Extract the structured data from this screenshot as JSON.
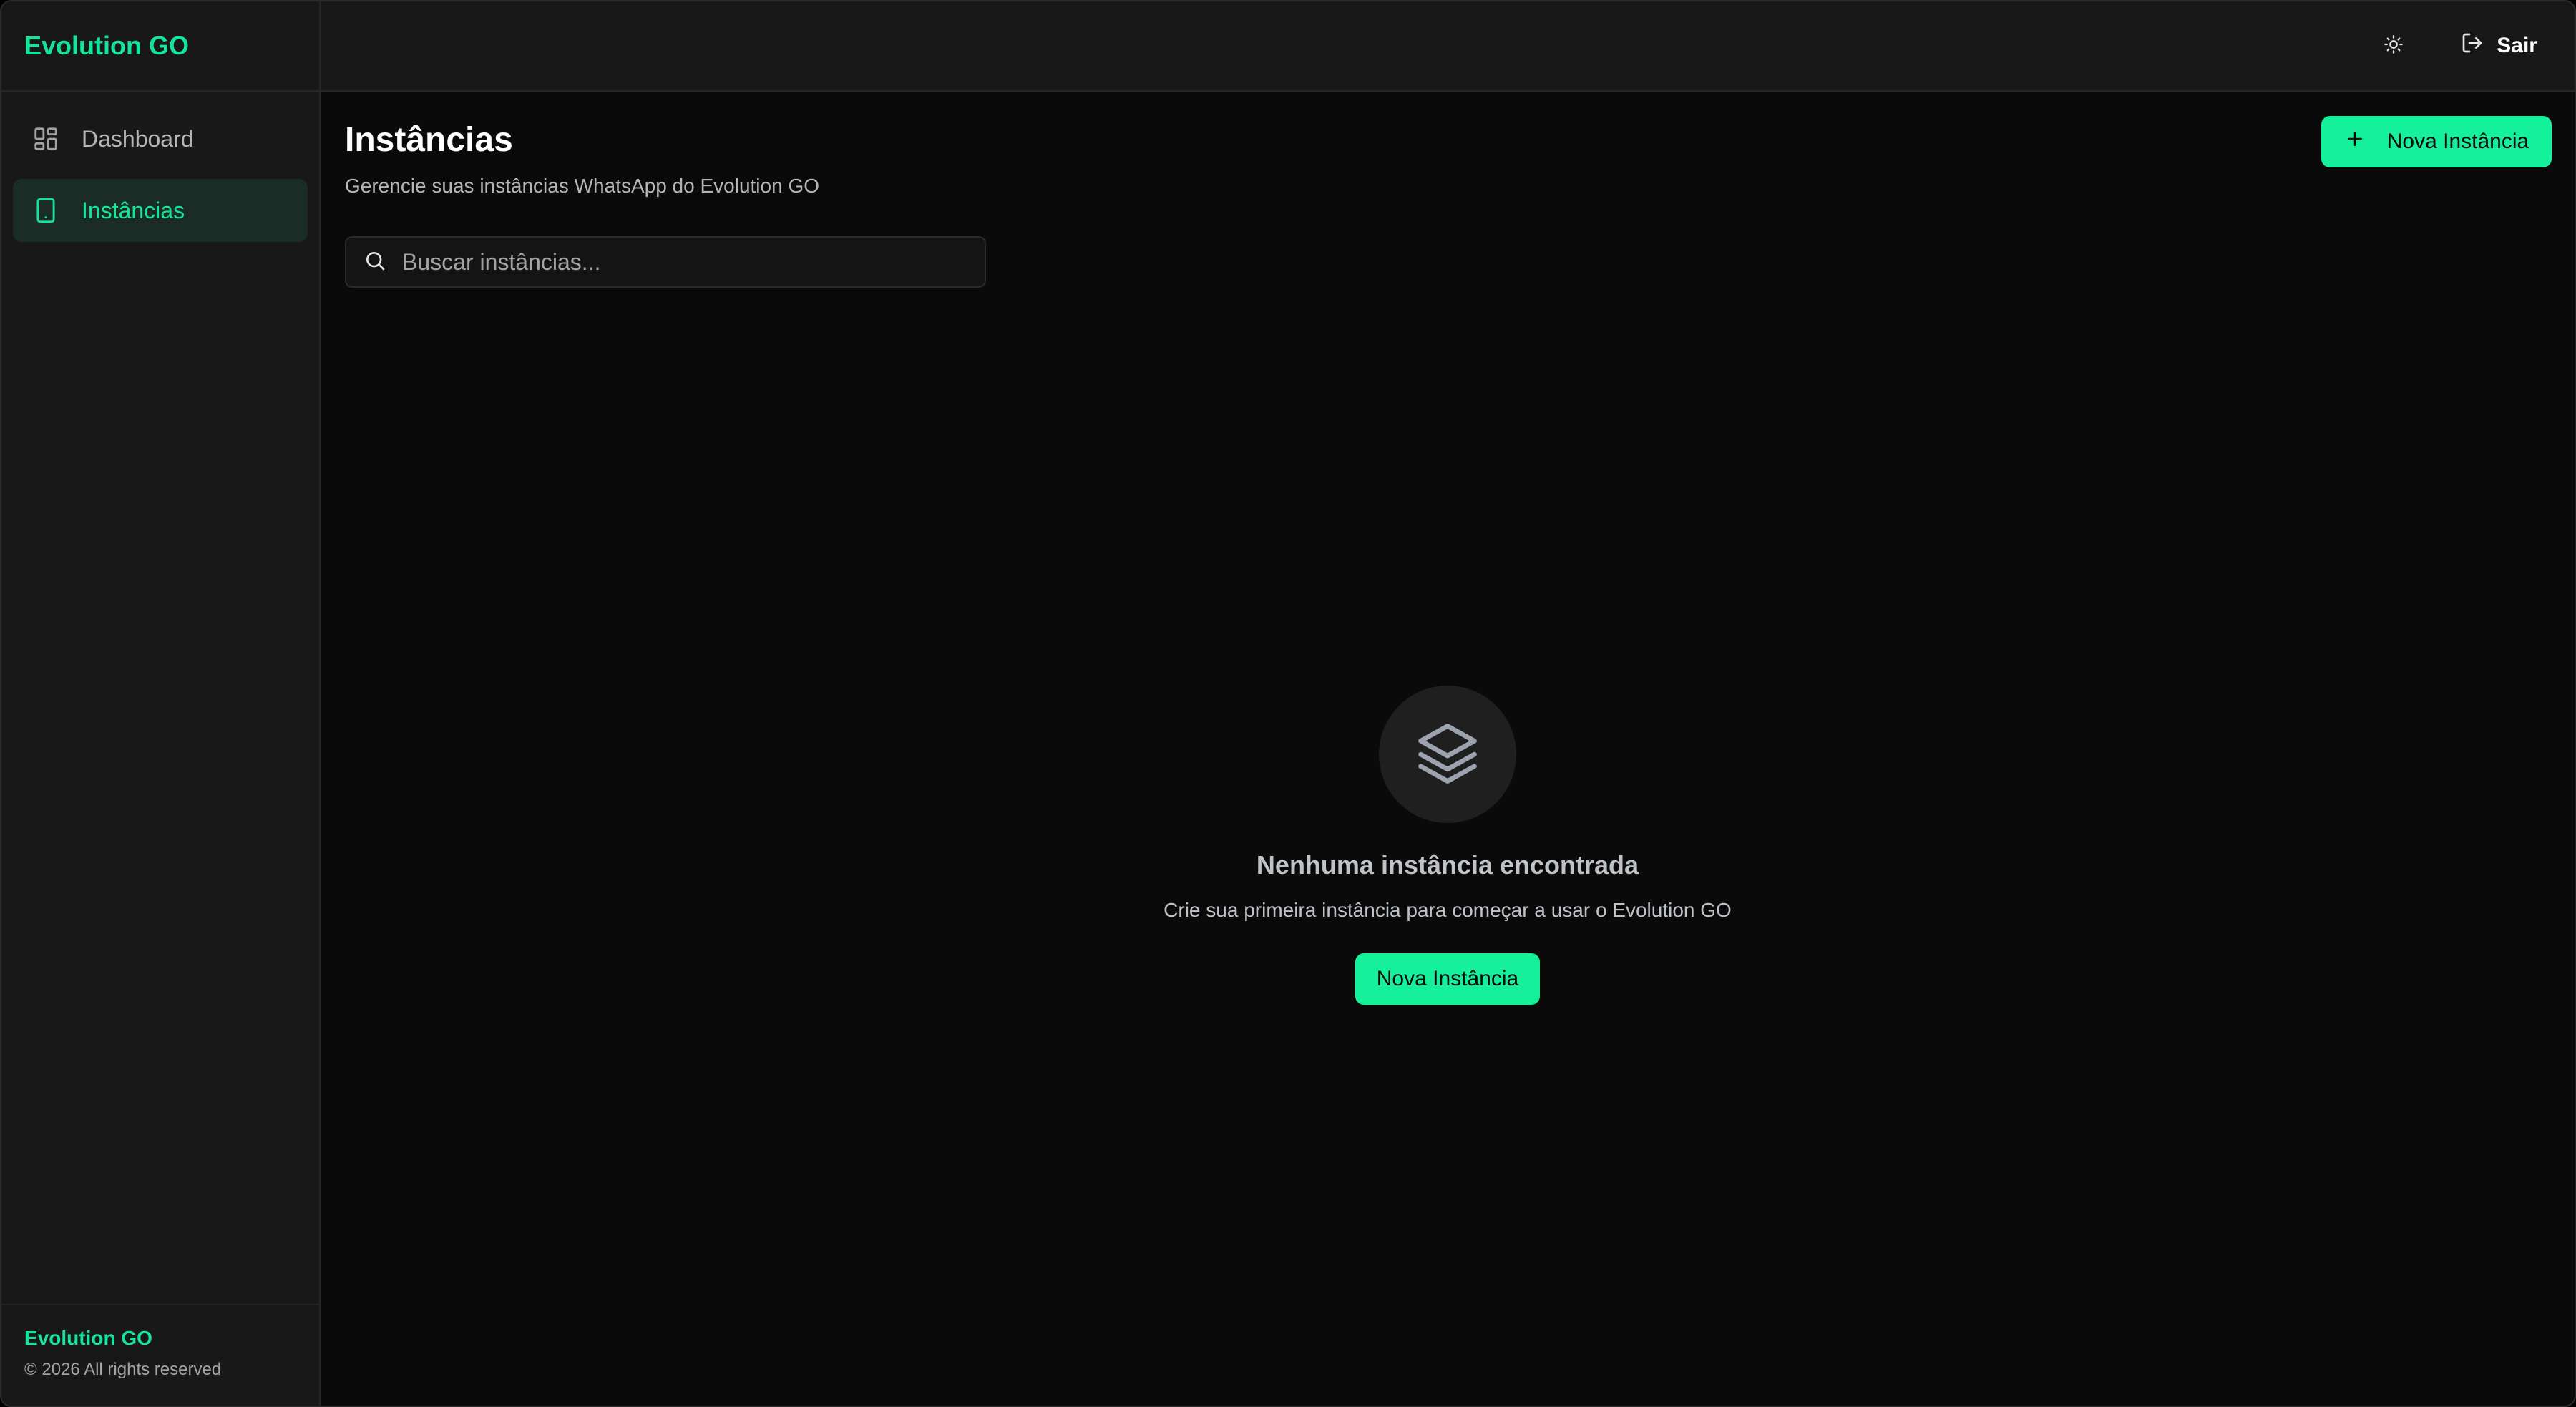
{
  "app": {
    "brand": "Evolution GO",
    "accent_color": "#15e59a"
  },
  "sidebar": {
    "items": [
      {
        "label": "Dashboard",
        "icon": "layout-grid-icon",
        "active": false
      },
      {
        "label": "Instâncias",
        "icon": "smartphone-icon",
        "active": true
      }
    ],
    "footer": {
      "brand": "Evolution GO",
      "copyright": "© 2026 All rights reserved"
    }
  },
  "topbar": {
    "theme_icon": "sun-icon",
    "logout_label": "Sair",
    "logout_icon": "log-out-icon"
  },
  "main": {
    "title": "Instâncias",
    "subtitle": "Gerencie suas instâncias WhatsApp do Evolution GO",
    "new_instance_label": "Nova Instância",
    "search": {
      "placeholder": "Buscar instâncias...",
      "value": ""
    },
    "empty_state": {
      "icon": "layers-icon",
      "title": "Nenhuma instância encontrada",
      "subtitle": "Crie sua primeira instância para começar a usar o Evolution GO",
      "button_label": "Nova Instância"
    }
  }
}
